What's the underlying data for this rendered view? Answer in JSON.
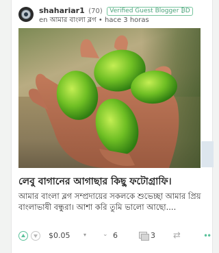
{
  "post": {
    "author": "shahariar1",
    "reputation": "(70)",
    "badge": "Verified Guest Blogger ₿D",
    "prefix": "en",
    "community": "আমার বাংলা ব্লগ",
    "separator": "•",
    "time": "hace 3 horas",
    "title": "লেবু বাগানের আগাছার কিছু ফটোগ্রাফি।",
    "snippet": "আমার বাংলা ব্লগ সম্প্রদায়ের সকলকে শুভেচ্ছা আমার প্রিয় বাংলাভাষী বন্ধুরা। আশা করি তুমি ভালো আছো....",
    "image_alt": "hand holding green lemons"
  },
  "footer": {
    "payout": "$0.05",
    "payout_caret": "▾",
    "voters_caret": "⌄",
    "votes": "6",
    "comments": "3",
    "resteem_icon": "⇄",
    "more_icon": "••"
  },
  "colors": {
    "accent": "#5bc29b",
    "badge": "#4ba37a"
  }
}
